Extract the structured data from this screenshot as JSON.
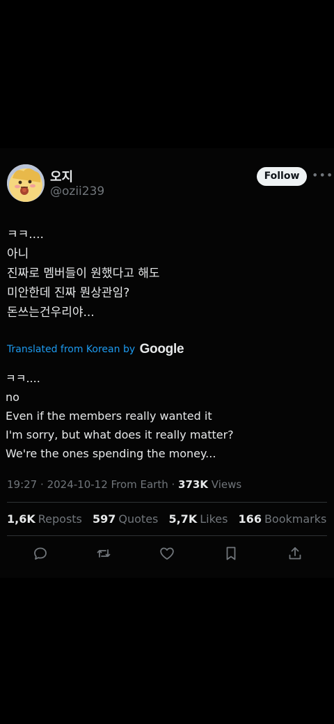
{
  "author": {
    "display_name": "오지",
    "handle": "@ozii239"
  },
  "follow_label": "Follow",
  "more_label": "•••",
  "tweet_lines": [
    "ㅋㅋ....",
    "아니",
    "진짜로 멤버들이 원했다고 해도",
    "미안한데 진짜 뭔상관임?",
    "돈쓰는건우리야..."
  ],
  "translation": {
    "label": "Translated from Korean by",
    "provider": "Google",
    "lines": [
      "ㅋㅋ....",
      "no",
      "Even if the members really wanted it",
      "I'm sorry, but what does it really matter?",
      "We're the ones spending the money..."
    ]
  },
  "meta": {
    "time": "19:27",
    "sep": "·",
    "date": "2024-10-12",
    "source": "From Earth",
    "views_count": "373K",
    "views_label": "Views"
  },
  "stats": {
    "reposts_count": "1,6K",
    "reposts_label": "Reposts",
    "quotes_count": "597",
    "quotes_label": "Quotes",
    "likes_count": "5,7K",
    "likes_label": "Likes",
    "bookmarks_count": "166",
    "bookmarks_label": "Bookmarks"
  },
  "actions": [
    "reply-icon",
    "retweet-icon",
    "heart-icon",
    "bookmark-icon",
    "share-icon"
  ],
  "colors": {
    "background": "#000000",
    "text": "#e7e9ea",
    "muted": "#71767b",
    "link": "#1d9bf0",
    "follow_bg": "#eff3f4"
  }
}
